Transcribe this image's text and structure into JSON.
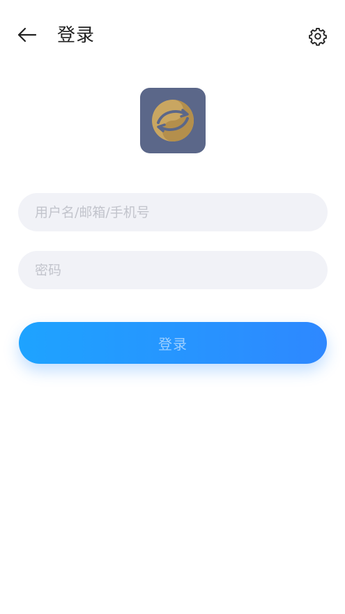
{
  "header": {
    "title": "登录",
    "back_icon": "arrow-left-icon",
    "settings_icon": "gear-icon"
  },
  "logo": {
    "icon": "app-logo-yin-yang",
    "background_color": "#5b6789",
    "accent_color": "#c9a661"
  },
  "form": {
    "username_placeholder": "用户名/邮箱/手机号",
    "username_value": "",
    "password_placeholder": "密码",
    "password_value": ""
  },
  "login_button": {
    "label": "登录",
    "gradient_start": "#1ea3ff",
    "gradient_end": "#2e88ff"
  }
}
